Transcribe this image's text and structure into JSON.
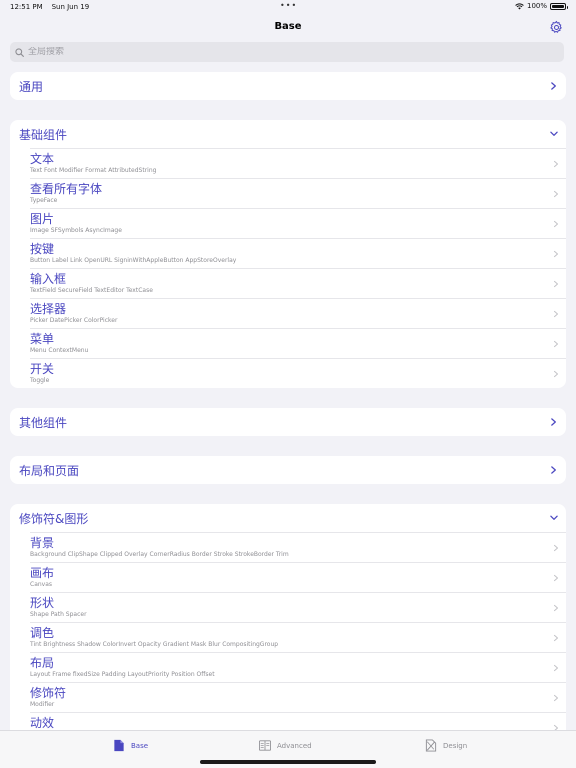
{
  "status_bar": {
    "time": "12:51 PM",
    "date": "Sun Jun 19",
    "dots": "•••",
    "battery": "100%",
    "battery_level": 1.0
  },
  "nav": {
    "title": "Base",
    "settings_icon": "gear-icon"
  },
  "search": {
    "placeholder": "全局搜索",
    "value": ""
  },
  "colors": {
    "accent": "#4a47c0",
    "secondary_text": "#8e8e93",
    "background": "#f2f2f7"
  },
  "sections": [
    {
      "title": "通用",
      "expanded": false,
      "items": []
    },
    {
      "title": "基础组件",
      "expanded": true,
      "items": [
        {
          "title": "文本",
          "subtitle": "Text Font Modifier Format AttributedString"
        },
        {
          "title": "查看所有字体",
          "subtitle": "TypeFace"
        },
        {
          "title": "图片",
          "subtitle": "Image SFSymbols AsyncImage"
        },
        {
          "title": "按键",
          "subtitle": "Button Label Link OpenURL SigninWithAppleButton  AppStoreOverlay"
        },
        {
          "title": "输入框",
          "subtitle": "TextField SecureField TextEditor TextCase"
        },
        {
          "title": "选择器",
          "subtitle": "Picker DatePicker ColorPicker"
        },
        {
          "title": "菜单",
          "subtitle": "Menu ContextMenu"
        },
        {
          "title": "开关",
          "subtitle": "Toggle"
        }
      ]
    },
    {
      "title": "其他组件",
      "expanded": false,
      "items": []
    },
    {
      "title": "布局和页面",
      "expanded": false,
      "items": []
    },
    {
      "title": "修饰符&图形",
      "expanded": true,
      "items": [
        {
          "title": "背景",
          "subtitle": "Background ClipShape  Clipped Overlay CornerRadius Border Stroke  StrokeBorder Trim"
        },
        {
          "title": "画布",
          "subtitle": "Canvas"
        },
        {
          "title": "形状",
          "subtitle": "Shape Path Spacer"
        },
        {
          "title": "调色",
          "subtitle": "Tint Brightness Shadow ColorInvert Opacity Gradient Mask Blur CompositingGroup"
        },
        {
          "title": "布局",
          "subtitle": "Layout Frame fixedSize Padding LayoutPriority Position Offset"
        },
        {
          "title": "修饰符",
          "subtitle": "Modifier"
        },
        {
          "title": "动效",
          "subtitle": ""
        }
      ]
    }
  ],
  "tabs": [
    {
      "label": "Base",
      "icon": "doc-icon",
      "active": true
    },
    {
      "label": "Advanced",
      "icon": "book-icon",
      "active": false
    },
    {
      "label": "Design",
      "icon": "design-doc-icon",
      "active": false
    }
  ]
}
